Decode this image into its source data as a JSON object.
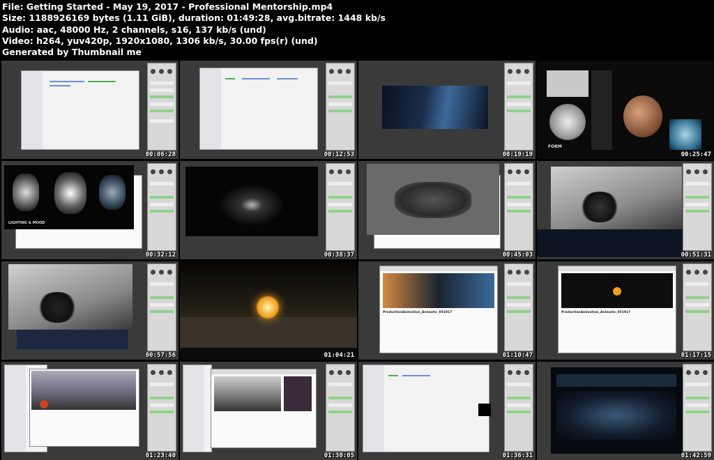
{
  "header": {
    "line1": "File: Getting Started - May 19, 2017 - Professional Mentorship.mp4",
    "line2": "Size: 1188926169 bytes (1.11 GiB), duration: 01:49:28, avg.bitrate: 1448 kb/s",
    "line3": "Audio: aac, 48000 Hz, 2 channels, s16, 137 kb/s (und)",
    "line4": "Video: h264, yuv420p, 1920x1080, 1306 kb/s, 30.00 fps(r) (und)",
    "line5": "Generated by Thumbnail me"
  },
  "thumbnails": [
    {
      "timestamp": "00:06:28"
    },
    {
      "timestamp": "00:12:53"
    },
    {
      "timestamp": "00:19:19"
    },
    {
      "timestamp": "00:25:47"
    },
    {
      "timestamp": "00:32:12"
    },
    {
      "timestamp": "00:38:37"
    },
    {
      "timestamp": "00:45:03"
    },
    {
      "timestamp": "00:51:31"
    },
    {
      "timestamp": "00:57:56"
    },
    {
      "timestamp": "01:04:21"
    },
    {
      "timestamp": "01:10:47"
    },
    {
      "timestamp": "01:17:15"
    },
    {
      "timestamp": "01:23:40"
    },
    {
      "timestamp": "01:30:05"
    },
    {
      "timestamp": "01:36:31"
    },
    {
      "timestamp": "01:42:59"
    }
  ],
  "frame_text": {
    "form_label": "FORM",
    "lighting_label": "LIGHTING & MOOD",
    "video_title_a": "ProductionAnimation_Animatic_051917",
    "video_title_b": "ProductionAnimation_Animatic_051917"
  }
}
